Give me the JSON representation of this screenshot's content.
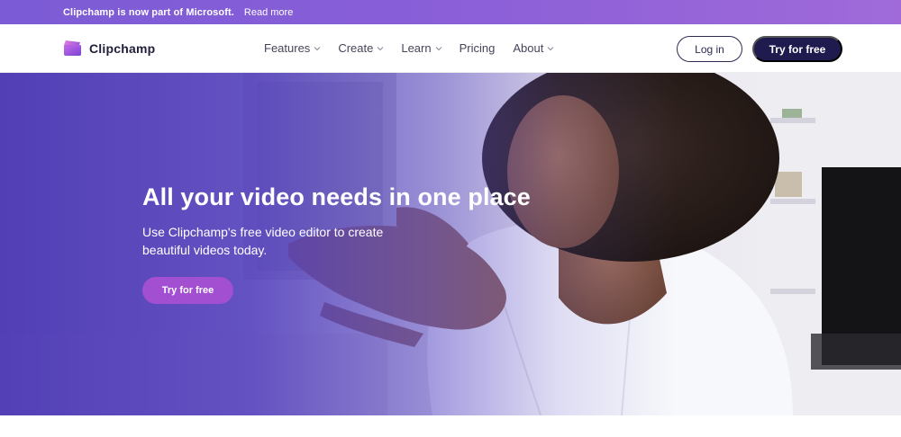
{
  "announcement": {
    "message": "Clipchamp is now part of Microsoft.",
    "link": "Read more"
  },
  "header": {
    "brand": "Clipchamp",
    "nav": [
      {
        "label": "Features",
        "has_dropdown": true
      },
      {
        "label": "Create",
        "has_dropdown": true
      },
      {
        "label": "Learn",
        "has_dropdown": true
      },
      {
        "label": "Pricing",
        "has_dropdown": false
      },
      {
        "label": "About",
        "has_dropdown": true
      }
    ],
    "login_label": "Log in",
    "try_label": "Try for free"
  },
  "hero": {
    "title": "All your video needs in one place",
    "subtitle": "Use Clipchamp's free video editor to create beautiful videos today.",
    "cta_label": "Try for free"
  },
  "colors": {
    "announcement_gradient_start": "#7b5bd6",
    "announcement_gradient_end": "#a06ad9",
    "header_cta_bg": "#1f1b4f",
    "hero_overlay": "#4834b4",
    "hero_cta_bg": "#a24fd1"
  },
  "icons": [
    "clipchamp-logo-icon",
    "chevron-down-icon"
  ]
}
